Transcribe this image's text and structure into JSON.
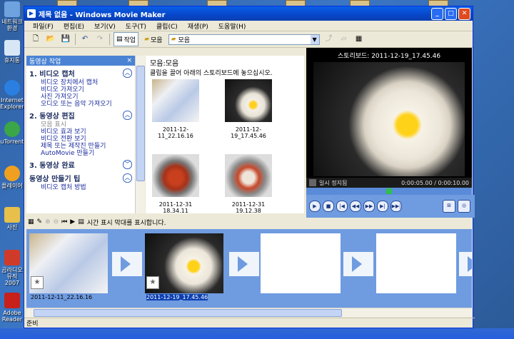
{
  "window": {
    "title": "제목 없음 - Windows Movie Maker",
    "menu": [
      "파일(F)",
      "편집(E)",
      "보기(V)",
      "도구(T)",
      "클립(C)",
      "재생(P)",
      "도움말(H)"
    ]
  },
  "toolbar": {
    "tasks_label": "작업",
    "collections_label": "모음",
    "collection_select": "모음"
  },
  "desktop_icons": [
    {
      "label": "네트워크\n환경"
    },
    {
      "label": "휴지통"
    },
    {
      "label": "Internet\nExplorer"
    },
    {
      "label": "uTorrent"
    },
    {
      "label": "플레이어"
    },
    {
      "label": "사진"
    },
    {
      "label": "곰라디오\n뮤직 2007"
    },
    {
      "label": "Adobe\nReader"
    }
  ],
  "tasks_pane": {
    "header": "동영상 작업",
    "close": "×",
    "sections": [
      {
        "title": "1. 비디오 캡처",
        "items": [
          {
            "label": "비디오 장치에서 캡처",
            "enabled": true
          },
          {
            "label": "비디오 가져오기",
            "enabled": true
          },
          {
            "label": "사진 가져오기",
            "enabled": true
          },
          {
            "label": "오디오 또는 음악 가져오기",
            "enabled": true
          }
        ]
      },
      {
        "title": "2. 동영상 편집",
        "items": [
          {
            "label": "모음 표시",
            "enabled": false
          },
          {
            "label": "비디오 효과 보기",
            "enabled": true
          },
          {
            "label": "비디오 전환 보기",
            "enabled": true
          },
          {
            "label": "제목 또는 제작진 만들기",
            "enabled": true
          },
          {
            "label": "AutoMovie 만들기",
            "enabled": true
          }
        ]
      },
      {
        "title": "3. 동영상 완료",
        "items": []
      },
      {
        "title": "동영상 만들기 팁",
        "items": [
          {
            "label": "비디오 캡처 방법",
            "enabled": true
          }
        ]
      }
    ]
  },
  "collection": {
    "title": "모음:모음",
    "hint": "클립을 끌어 아래의 스토리보드에 놓으십시오.",
    "clips": [
      {
        "name": "2011-12-11_22.16.16"
      },
      {
        "name": "2011-12-19_17.45.46"
      },
      {
        "name": "2011-12-31 18.34.11"
      },
      {
        "name": "2011-12-31 19.12.38"
      }
    ]
  },
  "preview": {
    "title": "스토리보드: 2011-12-19_17.45.46",
    "status": "일시 정지됨",
    "time": "0:00:05.00 / 0:00:10.00",
    "position_fraction": 0.5
  },
  "storyboard": {
    "timeline_toggle": "시간 표시 막대를 표시합니다.",
    "clips": [
      {
        "name": "2011-12-11_22.16.16"
      },
      {
        "name": "2011-12-19_17.45.46"
      }
    ]
  },
  "status": {
    "text": "준비"
  }
}
